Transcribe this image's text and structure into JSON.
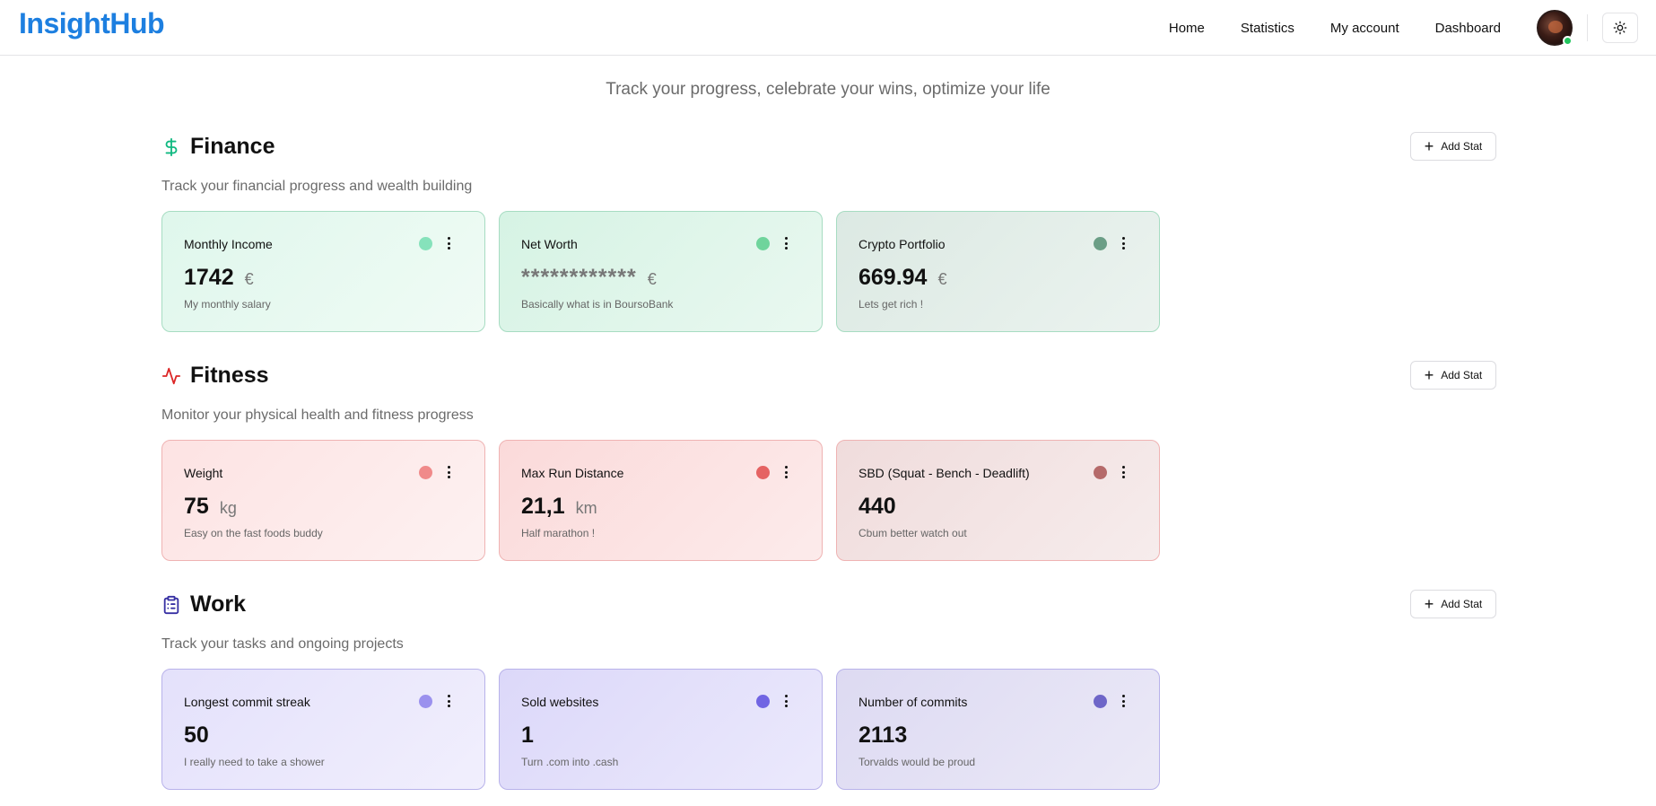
{
  "app": {
    "logo": "InsightHub"
  },
  "nav": {
    "items": [
      "Home",
      "Statistics",
      "My account",
      "Dashboard"
    ]
  },
  "header": {
    "avatar_status": "online",
    "theme_icon": "sun-icon"
  },
  "tagline": "Track your progress, celebrate your wins, optimize your life",
  "add_stat_label": "Add Stat",
  "sections": [
    {
      "title": "Finance",
      "icon": "dollar-icon",
      "accent": "#10b981",
      "description": "Track your financial progress and wealth building",
      "cards": [
        {
          "title": "Monthly Income",
          "value": "1742",
          "unit": "€",
          "description": "My monthly salary",
          "dot_color": "#86e2bb",
          "bg_from": "#dff7ec",
          "bg_to": "#f0fbf5"
        },
        {
          "title": "Net Worth",
          "value": "************",
          "unit": "€",
          "description": "Basically what is in BoursoBank",
          "dot_color": "#6fd49c",
          "bg_from": "#d6f3e4",
          "bg_to": "#e9f8f0"
        },
        {
          "title": "Crypto Portfolio",
          "value": "669.94",
          "unit": "€",
          "description": "Lets get rich !",
          "dot_color": "#6b9e86",
          "bg_from": "#dce9e3",
          "bg_to": "#ebf3ef"
        }
      ]
    },
    {
      "title": "Fitness",
      "icon": "activity-icon",
      "accent": "#dc2626",
      "description": "Monitor your physical health and fitness progress",
      "cards": [
        {
          "title": "Weight",
          "value": "75",
          "unit": "kg",
          "description": "Easy on the fast foods buddy",
          "dot_color": "#f08a8a",
          "bg_from": "#fde3e3",
          "bg_to": "#fdf1f1"
        },
        {
          "title": "Max Run Distance",
          "value": "21,1",
          "unit": "km",
          "description": "Half marathon !",
          "dot_color": "#e56363",
          "bg_from": "#fbdada",
          "bg_to": "#fcebeb"
        },
        {
          "title": "SBD (Squat - Bench - Deadlift)",
          "value": "440",
          "unit": "",
          "description": "Cbum better watch out",
          "dot_color": "#b56a6a",
          "bg_from": "#f0dcdc",
          "bg_to": "#f6ecec"
        }
      ]
    },
    {
      "title": "Work",
      "icon": "clipboard-icon",
      "accent": "#3730a3",
      "description": "Track your tasks and ongoing projects",
      "cards": [
        {
          "title": "Longest commit streak",
          "value": "50",
          "unit": "",
          "description": "I really need to take a shower",
          "dot_color": "#9b91ee",
          "bg_from": "#e4e1fb",
          "bg_to": "#f1effd"
        },
        {
          "title": "Sold websites",
          "value": "1",
          "unit": "",
          "description": "Turn .com into .cash",
          "dot_color": "#7165e3",
          "bg_from": "#dcd8f9",
          "bg_to": "#ebe9fc"
        },
        {
          "title": "Number of commits",
          "value": "2113",
          "unit": "",
          "description": "Torvalds would be proud",
          "dot_color": "#6e66c8",
          "bg_from": "#dddaf2",
          "bg_to": "#ebe9f7"
        }
      ]
    }
  ]
}
